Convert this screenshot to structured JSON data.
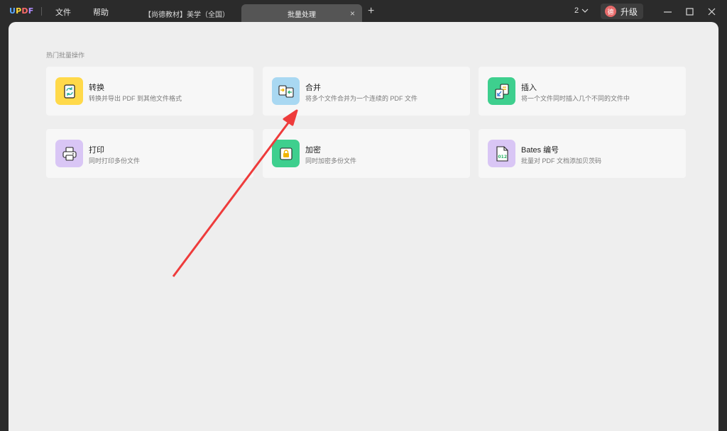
{
  "app": {
    "logo": {
      "u": "U",
      "p": "P",
      "d": "D",
      "f": "F"
    },
    "menu": {
      "file": "文件",
      "help": "帮助"
    },
    "tabs": [
      {
        "label": "【尚德教材】美学（全国）"
      },
      {
        "label": "批量处理",
        "close": "×"
      }
    ],
    "tab_add": "+",
    "count": "2",
    "upgrade": {
      "avatar": "德",
      "label": "升级"
    }
  },
  "main": {
    "section_label": "热门批量操作",
    "cards": [
      {
        "title": "转换",
        "desc": "转换并导出 PDF 到其他文件格式",
        "icon": "convert-icon",
        "color": "#ffd94a"
      },
      {
        "title": "合并",
        "desc": "将多个文件合并为一个连续的 PDF 文件",
        "icon": "merge-icon",
        "color": "#a9d8f2"
      },
      {
        "title": "插入",
        "desc": "将一个文件同时插入几个不同的文件中",
        "icon": "insert-icon",
        "color": "#3ecf8e"
      },
      {
        "title": "打印",
        "desc": "同时打印多份文件",
        "icon": "print-icon",
        "color": "#d9c6f5"
      },
      {
        "title": "加密",
        "desc": "同时加密多份文件",
        "icon": "encrypt-icon",
        "color": "#3ecf8e"
      },
      {
        "title": "Bates 编号",
        "desc": "批量对 PDF 文档添加贝茨码",
        "icon": "bates-number-icon",
        "color": "#d9c6f5",
        "icon_text": "012"
      }
    ]
  },
  "annotation": {
    "color": "#ee3b3b",
    "icon": "red-arrow-annotation"
  }
}
